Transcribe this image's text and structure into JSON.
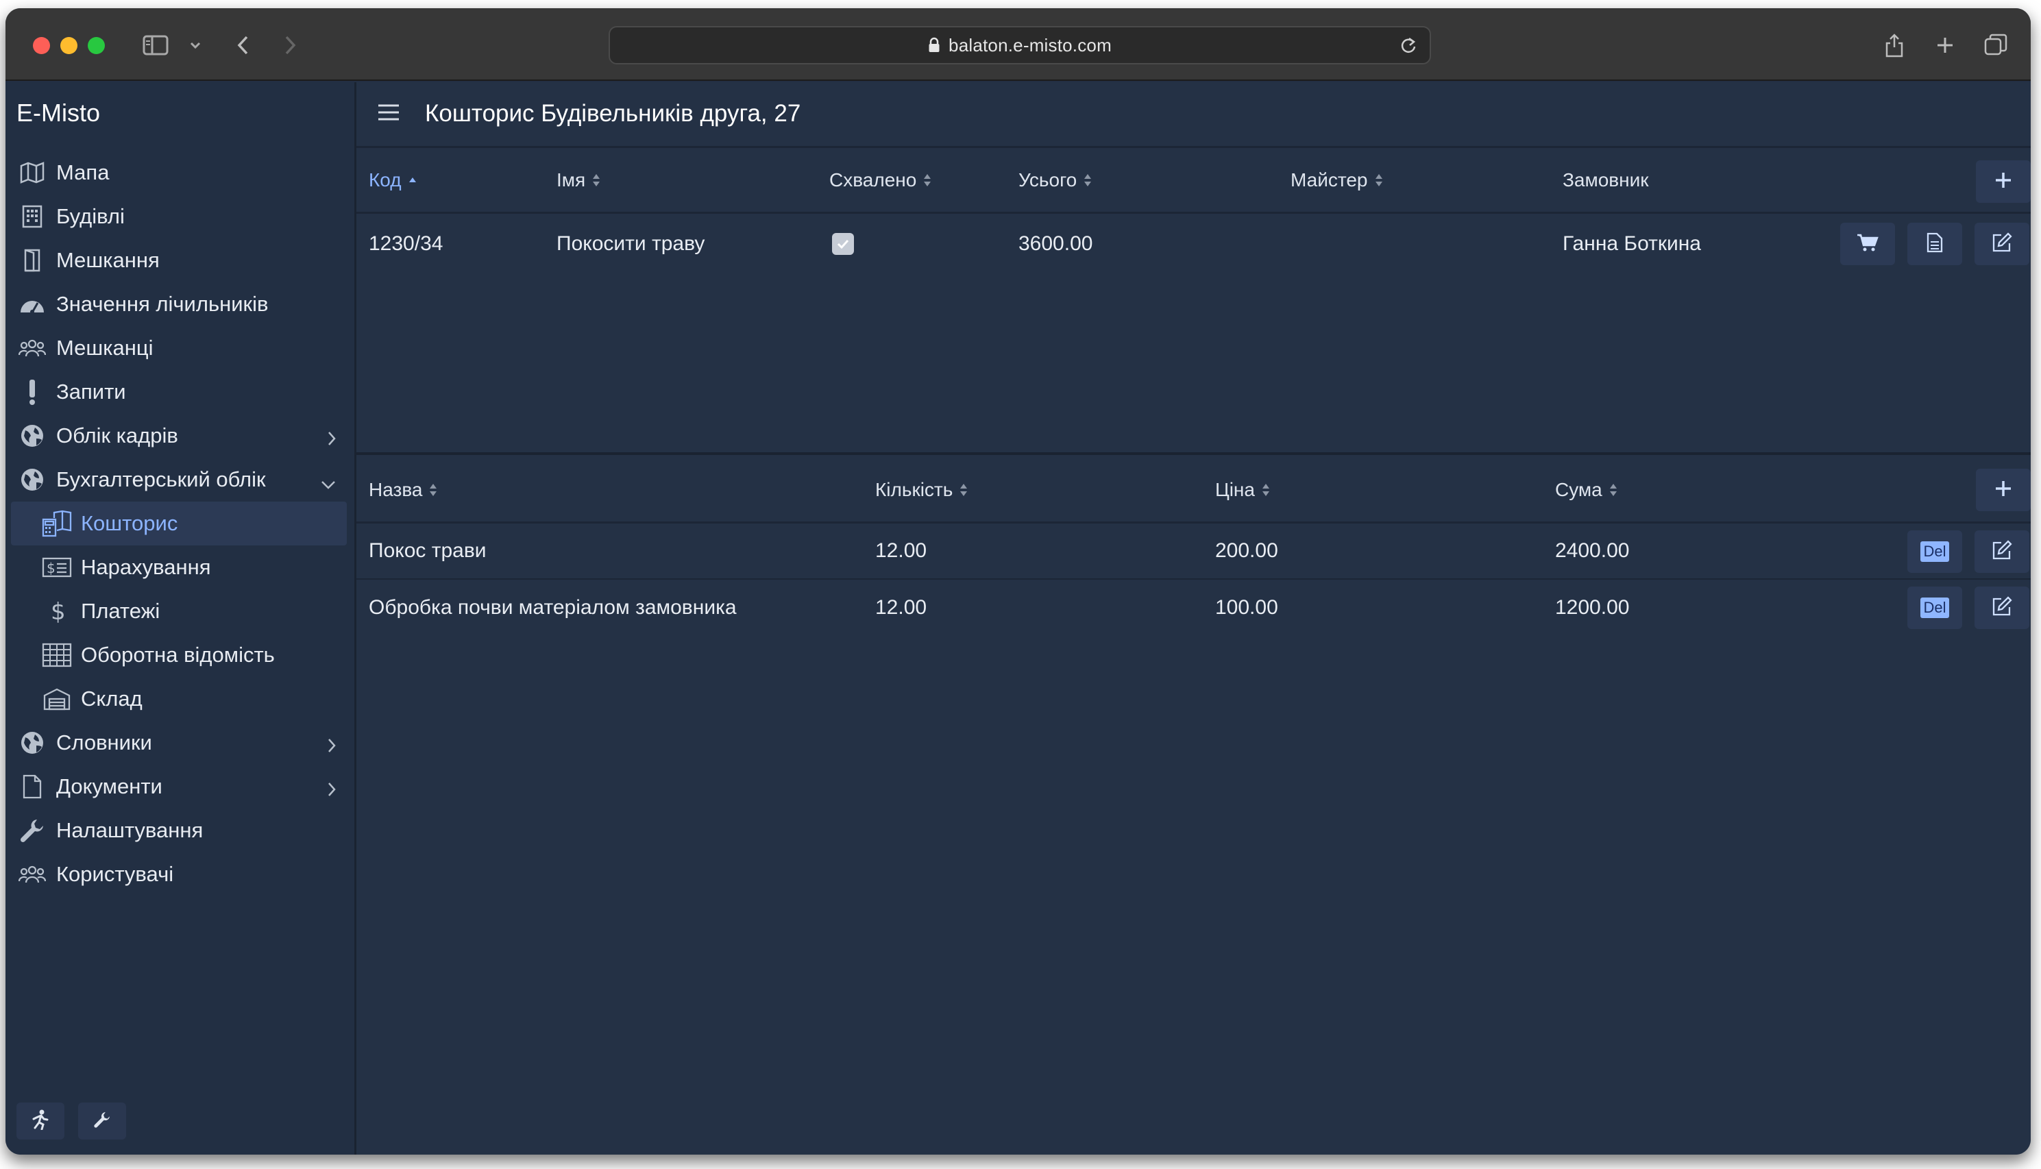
{
  "browser": {
    "url": "balaton.e-misto.com"
  },
  "app": {
    "brand": "E-Misto",
    "page_title": "Кошторис Будівельників друга, 27"
  },
  "sidebar": {
    "items": [
      {
        "label": "Мапа",
        "icon": "map-icon"
      },
      {
        "label": "Будівлі",
        "icon": "building-icon"
      },
      {
        "label": "Мешкання",
        "icon": "door-icon"
      },
      {
        "label": "Значення лічильників",
        "icon": "gauge-icon"
      },
      {
        "label": "Мешканці",
        "icon": "people-icon"
      },
      {
        "label": "Запити",
        "icon": "exclamation-icon"
      },
      {
        "label": "Облік кадрів",
        "icon": "globe-icon",
        "expandable": true
      },
      {
        "label": "Бухгалтерський облік",
        "icon": "globe-icon",
        "expanded": true
      },
      {
        "label": "Кошторис",
        "icon": "calculator-book-icon",
        "sub": true,
        "active": true
      },
      {
        "label": "Нарахування",
        "icon": "invoice-icon",
        "sub": true
      },
      {
        "label": "Платежі",
        "icon": "dollar-icon",
        "sub": true
      },
      {
        "label": "Оборотна відомість",
        "icon": "table-icon",
        "sub": true
      },
      {
        "label": "Склад",
        "icon": "warehouse-icon",
        "sub": true
      },
      {
        "label": "Словники",
        "icon": "globe-icon",
        "expandable": true
      },
      {
        "label": "Документи",
        "icon": "document-icon",
        "expandable": true
      },
      {
        "label": "Налаштування",
        "icon": "wrench-icon"
      },
      {
        "label": "Користувачі",
        "icon": "people-icon"
      }
    ]
  },
  "estimates_table": {
    "columns": [
      "Код",
      "Імя",
      "Схвалено",
      "Усього",
      "Майстер",
      "Замовник"
    ],
    "rows": [
      {
        "code": "1230/34",
        "name": "Покосити траву",
        "approved": true,
        "total": "3600.00",
        "master": "",
        "customer": "Ганна Боткина"
      }
    ]
  },
  "items_table": {
    "columns": [
      "Назва",
      "Кількість",
      "Ціна",
      "Сума"
    ],
    "rows": [
      {
        "name": "Покос трави",
        "qty": "12.00",
        "price": "200.00",
        "sum": "2400.00",
        "del": "Del"
      },
      {
        "name": "Обробка почви матеріалом замовника",
        "qty": "12.00",
        "price": "100.00",
        "sum": "1200.00",
        "del": "Del"
      }
    ]
  }
}
